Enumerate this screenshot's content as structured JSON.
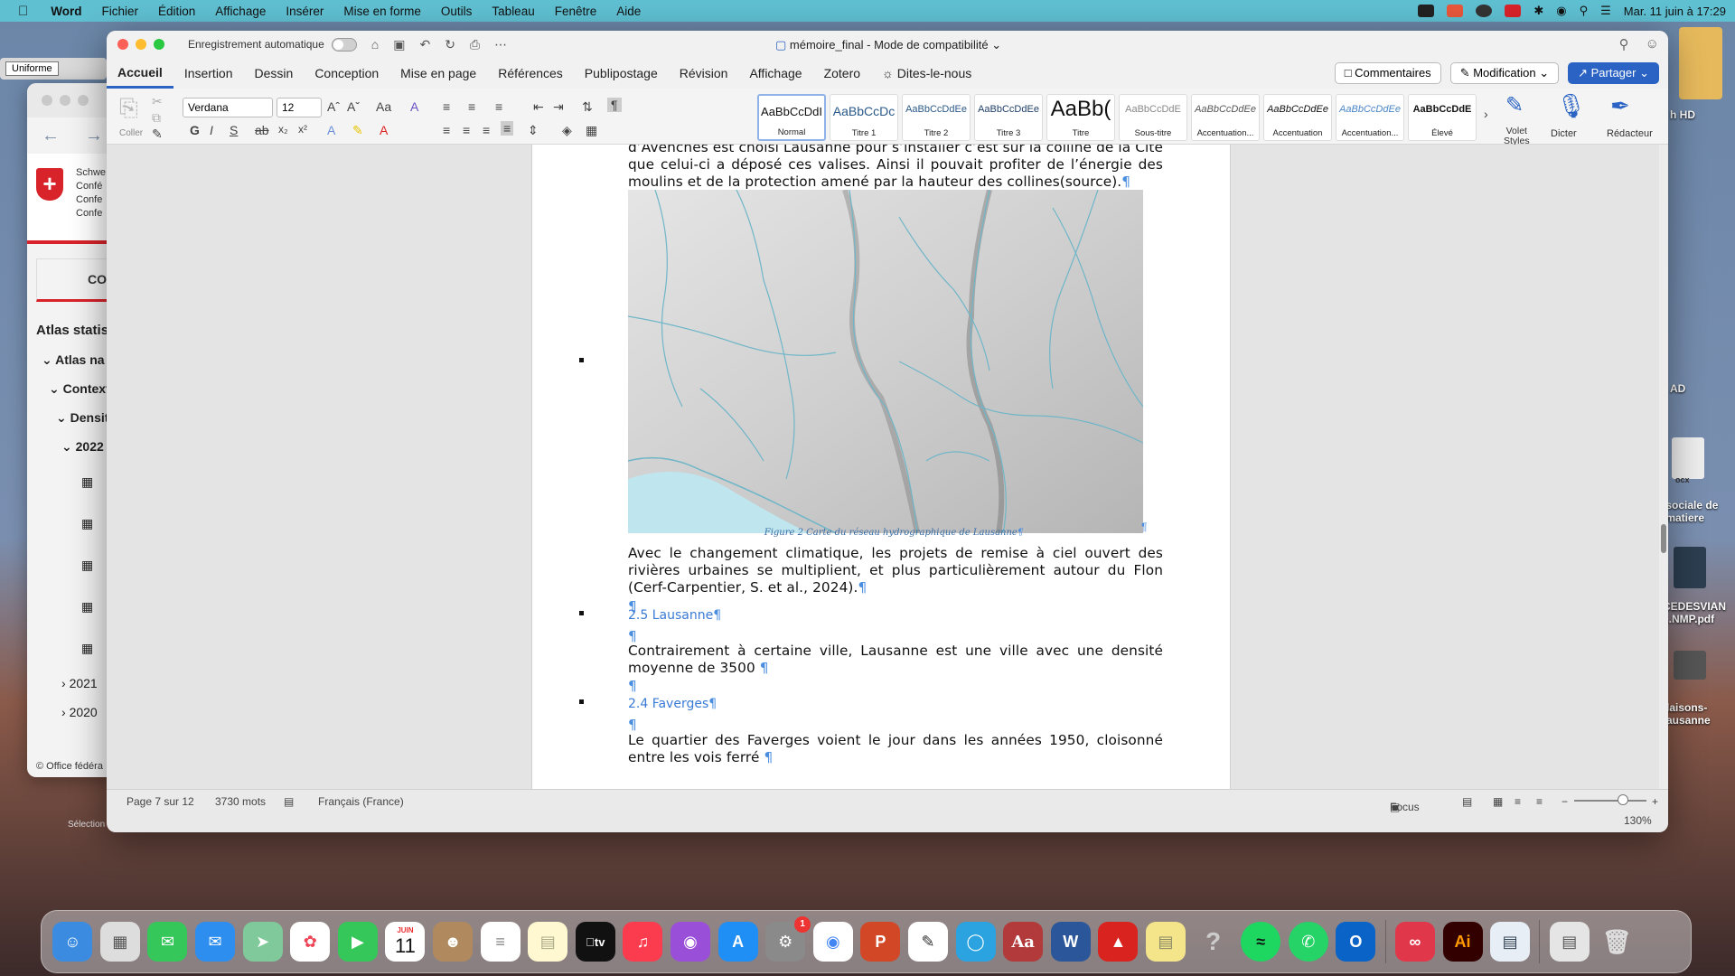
{
  "menubar": {
    "app": "Word",
    "items": [
      "Fichier",
      "Édition",
      "Affichage",
      "Insérer",
      "Mise en forme",
      "Outils",
      "Tableau",
      "Fenêtre",
      "Aide"
    ],
    "datetime": "Mar. 11 juin à  17:29"
  },
  "bg_window": {
    "toolbar_label": "Uniforme",
    "logo_lines": [
      "Schwe",
      "Confé",
      "Confe",
      "Confe"
    ],
    "co_label": "CO",
    "atlas_title": "Atlas statis",
    "tree": [
      "Atlas na",
      "Context",
      "Densit",
      "2022",
      "2021",
      "2020"
    ],
    "footer": "© Office fédéra",
    "selection_label": "Sélection"
  },
  "right_desktop": {
    "labels": [
      "h HD",
      "AD",
      "ocx",
      " sociale de\n matiere",
      "CEDESVIAN\n...NMP.pdf",
      "laisons-\nausanne"
    ]
  },
  "word": {
    "autosave_label": "Enregistrement automatique",
    "doc_title": "mémoire_final  -  Mode de compatibilité",
    "tabs": [
      "Accueil",
      "Insertion",
      "Dessin",
      "Conception",
      "Mise en page",
      "Références",
      "Publipostage",
      "Révision",
      "Affichage",
      "Zotero"
    ],
    "tell_me": "Dites-le-nous",
    "comments_button": "Commentaires",
    "mode_button": "Modification",
    "share_button": "Partager",
    "paste_label": "Coller",
    "font_name": "Verdana",
    "font_size": "12",
    "styles": [
      {
        "sample": "AaBbCcDdI",
        "name": "Normal"
      },
      {
        "sample": "AaBbCcDc",
        "name": "Titre 1"
      },
      {
        "sample": "AaBbCcDdEe",
        "name": "Titre 2"
      },
      {
        "sample": "AaBbCcDdEe",
        "name": "Titre 3"
      },
      {
        "sample": "AaBb(",
        "name": "Titre"
      },
      {
        "sample": "AaBbCcDdE",
        "name": "Sous-titre"
      },
      {
        "sample": "AaBbCcDdEe",
        "name": "Accentuation..."
      },
      {
        "sample": "AaBbCcDdEe",
        "name": "Accentuation"
      },
      {
        "sample": "AaBbCcDdEe",
        "name": "Accentuation..."
      },
      {
        "sample": "AaBbCcDdE",
        "name": "Élevé"
      }
    ],
    "styles_pane_label": "Volet\nStyles",
    "dictate_label": "Dicter",
    "editor_label": "Rédacteur",
    "document": {
      "intro_text": "d’Avenches est choisi Lausanne pour s’installer c’est sur la colline de la Cité que celui-ci a déposé ces valises. Ainsi il pouvait profiter de l’énergie des moulins et de la protection amené par la hauteur des collines(source).",
      "figure_caption": "Figure 2 Carte du réseau hydrographique de Lausanne",
      "para_climate": "Avec le changement climatique, les projets de remise à ciel ouvert des rivières urbaines se multiplient, et plus particulièrement autour du Flon (Cerf-Carpentier, S. et al., 2024).",
      "heading_lausanne": "2.5 Lausanne",
      "para_lausanne": "Contrairement à certaine ville, Lausanne est une ville avec une densité moyenne de 3500",
      "heading_faverges": "2.4 Faverges",
      "para_faverges": "Le quartier des Faverges voient le jour dans les années 1950, cloisonné entre les vois ferré",
      "pilcrow": "¶"
    },
    "status": {
      "page": "Page 7 sur 12",
      "words": "3730 mots",
      "language": "Français (France)",
      "focus": "Focus",
      "zoom": "130%",
      "zoom_minus": "−",
      "zoom_plus": "+"
    }
  },
  "dock": {
    "calendar_month": "JUIN",
    "calendar_day": "11",
    "settings_badge": "1",
    "appletv_label": "tv"
  }
}
